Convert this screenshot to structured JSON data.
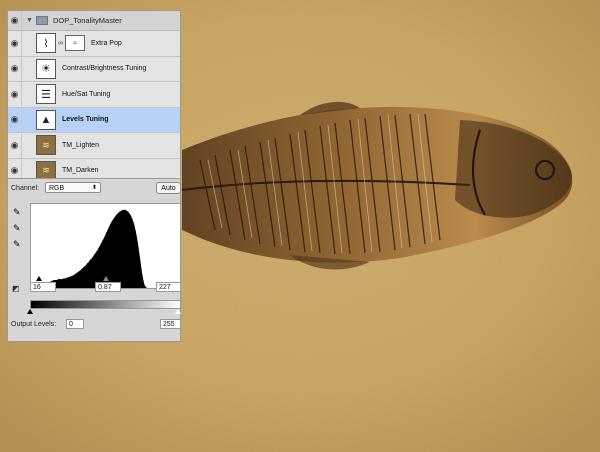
{
  "layers_group": {
    "name": "DOP_TonalityMaster"
  },
  "layers": [
    {
      "name": "Extra Pop",
      "icon": "curves-icon",
      "has_mask": true
    },
    {
      "name": "Contrast/Brightness Tuning",
      "icon": "brightness-icon",
      "has_mask": false
    },
    {
      "name": "Hue/Sat Tuning",
      "icon": "hue-sat-icon",
      "has_mask": false
    },
    {
      "name": "Levels Tuning",
      "icon": "levels-icon",
      "has_mask": false,
      "selected": true
    },
    {
      "name": "TM_Lighten",
      "icon": "fossil-thumb-icon",
      "has_mask": false
    },
    {
      "name": "TM_Darken",
      "icon": "fossil-thumb-icon",
      "has_mask": false
    }
  ],
  "levels": {
    "channel_label": "Channel:",
    "channel_value": "RGB",
    "auto_label": "Auto",
    "input_black": "16",
    "input_gamma": "0.87",
    "input_white": "227",
    "output_label": "Output Levels:",
    "output_black": "0",
    "output_white": "255",
    "histogram_bins": [
      0,
      0,
      0,
      0,
      0,
      0,
      0,
      0,
      0,
      0,
      0,
      0,
      0,
      0,
      0,
      0,
      0,
      0,
      0,
      0,
      1,
      1,
      1,
      2,
      2,
      2,
      3,
      3,
      4,
      4,
      5,
      5,
      6,
      7,
      7,
      8,
      8,
      9,
      9,
      9,
      10,
      10,
      10,
      10,
      10,
      10,
      10,
      10,
      11,
      11,
      11,
      11,
      11,
      11,
      11,
      11,
      11,
      11,
      12,
      12,
      12,
      12,
      12,
      12,
      13,
      13,
      13,
      13,
      14,
      14,
      14,
      14,
      15,
      15,
      15,
      16,
      16,
      16,
      17,
      17,
      18,
      18,
      19,
      19,
      20,
      20,
      21,
      21,
      22,
      22,
      23,
      24,
      24,
      25,
      26,
      26,
      27,
      28,
      28,
      29,
      30,
      31,
      31,
      32,
      33,
      34,
      35,
      36,
      36,
      37,
      38,
      39,
      40,
      41,
      42,
      43,
      44,
      45,
      46,
      47,
      48,
      50,
      51,
      52,
      53,
      55,
      56,
      57,
      59,
      60,
      61,
      63,
      64,
      66,
      67,
      69,
      70,
      72,
      73,
      75,
      76,
      78,
      79,
      80,
      82,
      83,
      84,
      85,
      86,
      87,
      88,
      89,
      90,
      91,
      92,
      92,
      93,
      94,
      94,
      95,
      95,
      96,
      96,
      96,
      97,
      97,
      97,
      97,
      97,
      97,
      97,
      96,
      96,
      95,
      95,
      94,
      93,
      92,
      91,
      90,
      88,
      87,
      85,
      83,
      81,
      79,
      76,
      73,
      70,
      66,
      62,
      58,
      54,
      49,
      44,
      39,
      34,
      29,
      24,
      19,
      15,
      11,
      8,
      5,
      3,
      2,
      1,
      1,
      0,
      0,
      0,
      0,
      0,
      0,
      0,
      0,
      0,
      0,
      0,
      0,
      0,
      0,
      0,
      0,
      0,
      0,
      0,
      0,
      0,
      0,
      0,
      0,
      0,
      0,
      0,
      0,
      0,
      0,
      0,
      0,
      0,
      0,
      0,
      0,
      0,
      0,
      0,
      0,
      0,
      0,
      0,
      0,
      0,
      0,
      0,
      0,
      0,
      0,
      0,
      0,
      0,
      0,
      0,
      0,
      0,
      0,
      0,
      0
    ]
  }
}
